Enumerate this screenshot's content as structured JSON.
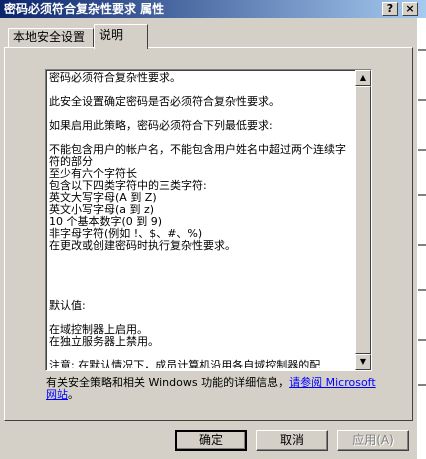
{
  "window": {
    "title": "密码必须符合复杂性要求 属性",
    "help_btn": "?",
    "close_btn": "×"
  },
  "tabs": [
    {
      "label": "本地安全设置"
    },
    {
      "label": "说明"
    }
  ],
  "description": {
    "text": "密码必须符合复杂性要求。\n\n此安全设置确定密码是否必须符合复杂性要求。\n\n如果启用此策略，密码必须符合下列最低要求:\n\n不能包含用户的帐户名，不能包含用户姓名中超过两个连续字符的部分\n至少有六个字符长\n包含以下四类字符中的三类字符:\n英文大写字母(A 到 Z)\n英文小写字母(a 到 z)\n10 个基本数字(0 到 9)\n非字母字符(例如 !、$、#、%)\n在更改或创建密码时执行复杂性要求。\n\n\n\n\n默认值:\n\n在域控制器上启用。\n在独立服务器上禁用。\n\n注意: 在默认情况下，成员计算机沿用各自域控制器的配"
  },
  "info": {
    "prefix": "有关安全策略和相关 Windows 功能的详细信息，",
    "link": "请参阅 Microsoft 网站",
    "suffix": "。"
  },
  "buttons": {
    "ok": "确定",
    "cancel": "取消",
    "apply": "应用(A)"
  },
  "scrollbar": {
    "up": "▲",
    "down": "▼"
  }
}
